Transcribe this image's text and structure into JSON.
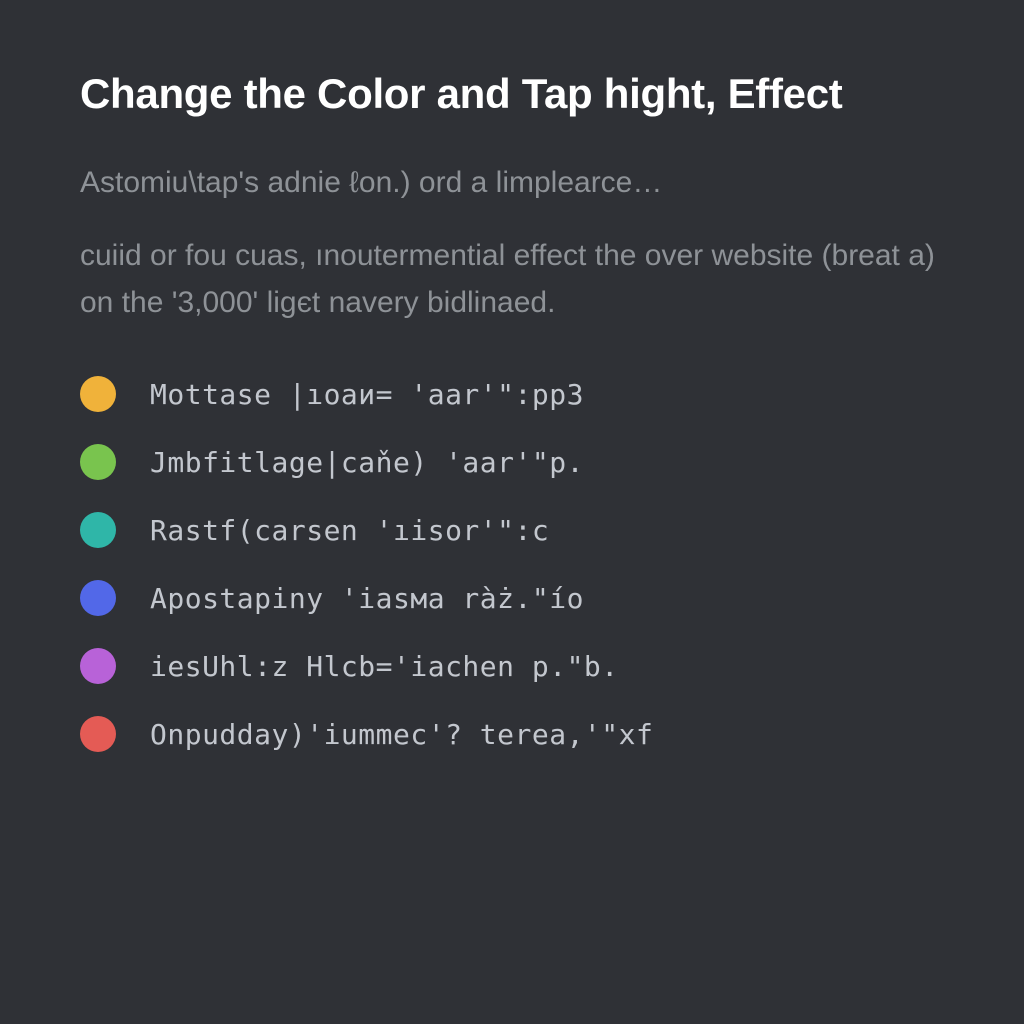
{
  "title": "Change the Color and Tap hight, Effect",
  "lead": "Astomiu\\tap's adnie ℓon.) ord a limplearce…",
  "paragraph": "cuiid or fou cuas, ınoutermential effect the over website (breat a) on the '3,000' ligєt navery bidlinaed.",
  "items": [
    {
      "color": "#f0b23a",
      "label": "Mottase |ıoaи= 'aar'\":pp3"
    },
    {
      "color": "#79c44e",
      "label": "Jmbfitlage|caňe) 'aar'\"p."
    },
    {
      "color": "#2fb6a8",
      "label": "Rastf(carsen 'ıisor'\":c"
    },
    {
      "color": "#5268e8",
      "label": "Apostapiny 'iasма ràż.\"ío"
    },
    {
      "color": "#b862d8",
      "label": "iesUhl:z Hlcb='iachen p.\"b."
    },
    {
      "color": "#e45b55",
      "label": "Onpudday)'iummec'? terea,'\"xf"
    }
  ]
}
